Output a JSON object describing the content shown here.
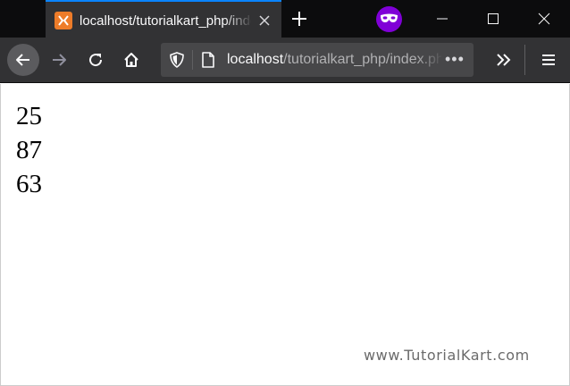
{
  "browser": {
    "tab": {
      "title": "localhost/tutorialkart_php/index.php",
      "favicon": "xampp-icon",
      "close_icon": "close-icon"
    },
    "new_tab_icon": "plus-icon",
    "private_browsing_icon": "private-mask-icon",
    "window_controls": {
      "minimize_icon": "minimize-icon",
      "maximize_icon": "maximize-icon",
      "close_icon": "close-icon"
    },
    "toolbar": {
      "back_icon": "back-arrow-icon",
      "forward_icon": "forward-arrow-icon",
      "reload_icon": "reload-icon",
      "home_icon": "home-icon",
      "overflow_icon": "chevron-double-right-icon",
      "menu_icon": "hamburger-menu-icon"
    },
    "urlbar": {
      "tracking_protection_icon": "shield-icon",
      "page_info_icon": "page-icon",
      "host": "localhost",
      "path": "/tutorialkart_php/index.php",
      "page_actions_label": "•••"
    }
  },
  "page": {
    "numbers": [
      "25",
      "87",
      "63"
    ],
    "watermark": "www.TutorialKart.com"
  },
  "colors": {
    "titlebar": "#0c0c0d",
    "toolbar": "#323234",
    "urlbar": "#474749",
    "tab_accent": "#0a84ff",
    "private_purple": "#8000d7",
    "favicon_orange": "#ee7c29"
  }
}
